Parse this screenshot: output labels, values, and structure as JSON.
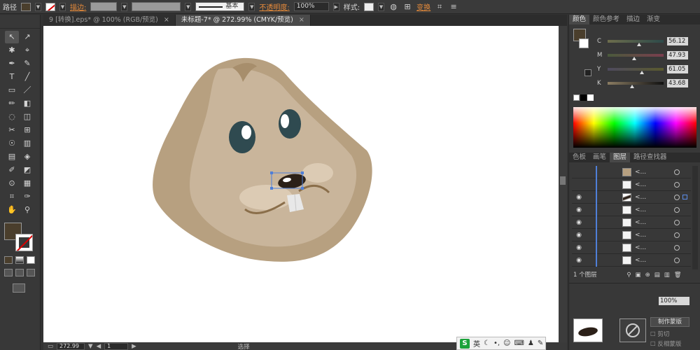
{
  "control_bar": {
    "object_type": "路径",
    "stroke_label": "描边:",
    "stroke_style": "基本",
    "opacity_label": "不透明度:",
    "opacity_value": "100%",
    "style_label": "样式:",
    "transform_label": "变换"
  },
  "tabs": [
    {
      "label": "9 [转换].eps* @ 100% (RGB/预览)"
    },
    {
      "label": "未标题-7* @ 272.99% (CMYK/预览)"
    }
  ],
  "tab_close": "×",
  "tools": [
    "↖",
    "↗",
    "✱",
    "⌖",
    "✒",
    "✎",
    "T",
    "╱",
    "▭",
    "／",
    "✏",
    "◧",
    "◌",
    "◫",
    "✂",
    "⊞",
    "☉",
    "▥",
    "▤",
    "◈",
    "✐",
    "◩",
    "⊙",
    "▦",
    "⌗",
    "✑",
    "✋",
    "⚲"
  ],
  "colors": {
    "fill": "#4a3e2c",
    "face": "#c9b59b",
    "accent": "#e58a3a",
    "layer_bar": "#4f7fd8"
  },
  "color_panel": {
    "tabs": [
      "颜色",
      "颜色参考",
      "描边",
      "渐变"
    ],
    "channels": [
      {
        "name": "C",
        "value": "56.12"
      },
      {
        "name": "M",
        "value": "47.93"
      },
      {
        "name": "Y",
        "value": "61.05"
      },
      {
        "name": "K",
        "value": "43.68"
      }
    ]
  },
  "layers_panel": {
    "tabs": [
      "色板",
      "画笔",
      "图层",
      "路径查找器"
    ],
    "rows": [
      {
        "name": "<...",
        "eye": "",
        "selected": false
      },
      {
        "name": "<...",
        "eye": "",
        "selected": false
      },
      {
        "name": "<...",
        "eye": "◉",
        "selected": true
      },
      {
        "name": "<...",
        "eye": "◉",
        "selected": false
      },
      {
        "name": "<...",
        "eye": "◉",
        "selected": false
      },
      {
        "name": "<...",
        "eye": "◉",
        "selected": false
      },
      {
        "name": "<...",
        "eye": "◉",
        "selected": false
      },
      {
        "name": "<...",
        "eye": "◉",
        "selected": false
      }
    ],
    "footer": "1 个图层"
  },
  "transparency_panel": {
    "opacity_value": "100%",
    "make_mask": "制作蒙版",
    "clip": "剪切",
    "invert_mask": "反相蒙版"
  },
  "status_bar": {
    "zoom": "272.99",
    "page": "1",
    "tool_status": "选择"
  },
  "ime": {
    "logo": "S",
    "lang": "英"
  }
}
